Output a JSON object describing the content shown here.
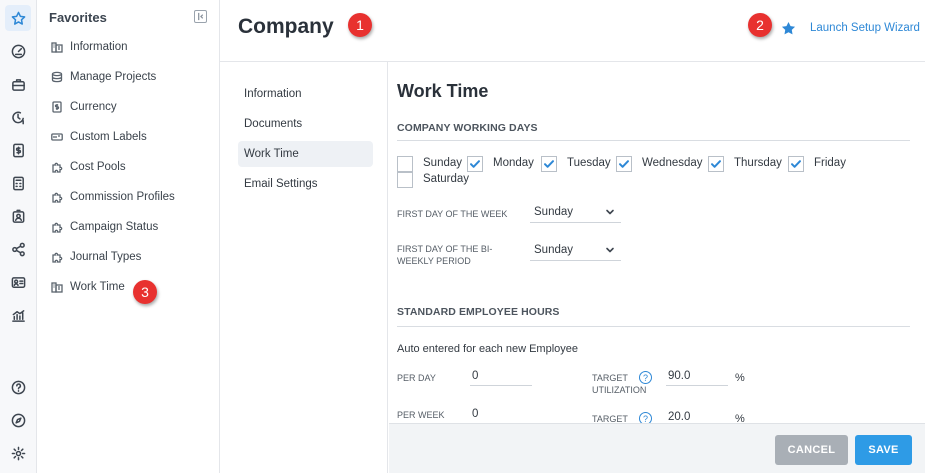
{
  "rail": {
    "icons": [
      "star-icon",
      "compass-dial-icon",
      "briefcase-icon",
      "clock-dollar-icon",
      "dollar-doc-icon",
      "calculator-icon",
      "id-badge-icon",
      "share-nodes-icon",
      "contact-card-icon",
      "analytics-icon",
      "help-circle-icon",
      "compass-icon",
      "settings-gear-icon"
    ]
  },
  "favorites": {
    "title": "Favorites",
    "items": [
      {
        "label": "Information",
        "icon": "building-icon"
      },
      {
        "label": "Manage Projects",
        "icon": "database-icon"
      },
      {
        "label": "Currency",
        "icon": "currency-doc-icon"
      },
      {
        "label": "Custom Labels",
        "icon": "label-tag-icon"
      },
      {
        "label": "Cost Pools",
        "icon": "puzzle-icon"
      },
      {
        "label": "Commission Profiles",
        "icon": "puzzle-icon"
      },
      {
        "label": "Campaign Status",
        "icon": "puzzle-icon"
      },
      {
        "label": "Journal Types",
        "icon": "puzzle-icon"
      },
      {
        "label": "Work Time",
        "icon": "building-icon"
      }
    ]
  },
  "badges": {
    "b1": "1",
    "b2": "2",
    "b3": "3"
  },
  "header": {
    "title": "Company",
    "wizard_label": "Launch Setup Wizard"
  },
  "subnav": {
    "items": [
      {
        "label": "Information",
        "active": false
      },
      {
        "label": "Documents",
        "active": false
      },
      {
        "label": "Work Time",
        "active": true
      },
      {
        "label": "Email Settings",
        "active": false
      }
    ]
  },
  "worktime": {
    "title": "Work Time",
    "working_days_heading": "COMPANY WORKING DAYS",
    "days": [
      {
        "label": "Sunday",
        "checked": false
      },
      {
        "label": "Monday",
        "checked": true
      },
      {
        "label": "Tuesday",
        "checked": true
      },
      {
        "label": "Wednesday",
        "checked": true
      },
      {
        "label": "Thursday",
        "checked": true
      },
      {
        "label": "Friday",
        "checked": true
      },
      {
        "label": "Saturday",
        "checked": false
      }
    ],
    "first_day_week_label": "FIRST DAY OF THE WEEK",
    "first_day_week_value": "Sunday",
    "first_day_biweekly_label_1": "FIRST DAY OF THE BI-",
    "first_day_biweekly_label_2": "WEEKLY PERIOD",
    "first_day_biweekly_value": "Sunday",
    "hours_heading": "STANDARD EMPLOYEE HOURS",
    "auto_text": "Auto entered for each new Employee",
    "per_day_label": "PER DAY",
    "per_day_value": "0",
    "per_week_label": "PER WEEK",
    "per_week_value": "0",
    "target_util_label_1": "TARGET",
    "target_util_label_2": "UTILIZATION",
    "target_util_value": "90.0",
    "target2_label": "TARGET",
    "target2_value": "20.0",
    "pct": "%",
    "help": "?"
  },
  "footer": {
    "cancel_label": "CANCEL",
    "save_label": "SAVE"
  },
  "colors": {
    "accent": "#2e88d6",
    "badge": "#e8312f",
    "save": "#2e9be6",
    "cancel": "#a9afb6"
  }
}
